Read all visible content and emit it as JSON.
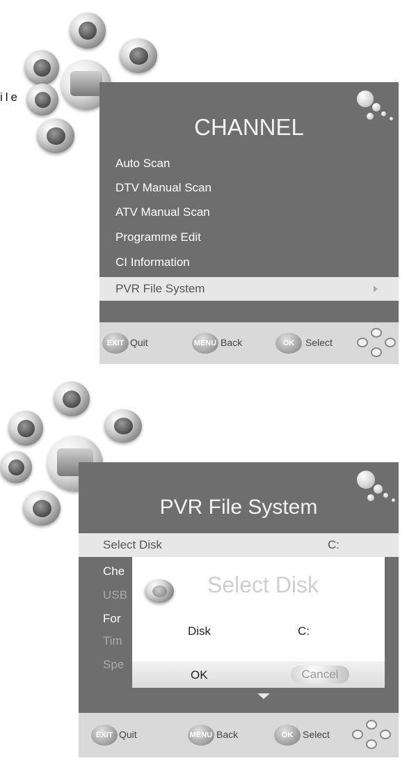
{
  "top_left_label": "ile",
  "channel_menu": {
    "title": "CHANNEL",
    "items": [
      {
        "label": "Auto Scan"
      },
      {
        "label": "DTV Manual Scan"
      },
      {
        "label": "ATV Manual Scan"
      },
      {
        "label": "Programme Edit"
      },
      {
        "label": "CI Information"
      },
      {
        "label": "PVR File System"
      }
    ],
    "selected_index": 5
  },
  "footer": {
    "exit_btn": "EXIT",
    "exit_label": "Quit",
    "menu_btn": "MENU",
    "menu_label": "Back",
    "ok_btn": "OK",
    "ok_label": "Select"
  },
  "pvr_menu": {
    "title": "PVR File System",
    "select_disk_label": "Select Disk",
    "select_disk_value": "C:",
    "items_partial": [
      {
        "label": "Che"
      },
      {
        "label": "USB"
      },
      {
        "label": "For"
      },
      {
        "label": "Tim"
      },
      {
        "label": "Spe"
      }
    ]
  },
  "dialog": {
    "title": "Select Disk",
    "disk_label": "Disk",
    "disk_value": "C:",
    "ok_label": "OK",
    "cancel_label": "Cancel"
  },
  "footer2": {
    "exit_btn": "EXIT",
    "exit_label": "Quit",
    "menu_btn": "MENU",
    "menu_label": "Back",
    "ok_btn": "OK",
    "ok_label": "Select"
  }
}
